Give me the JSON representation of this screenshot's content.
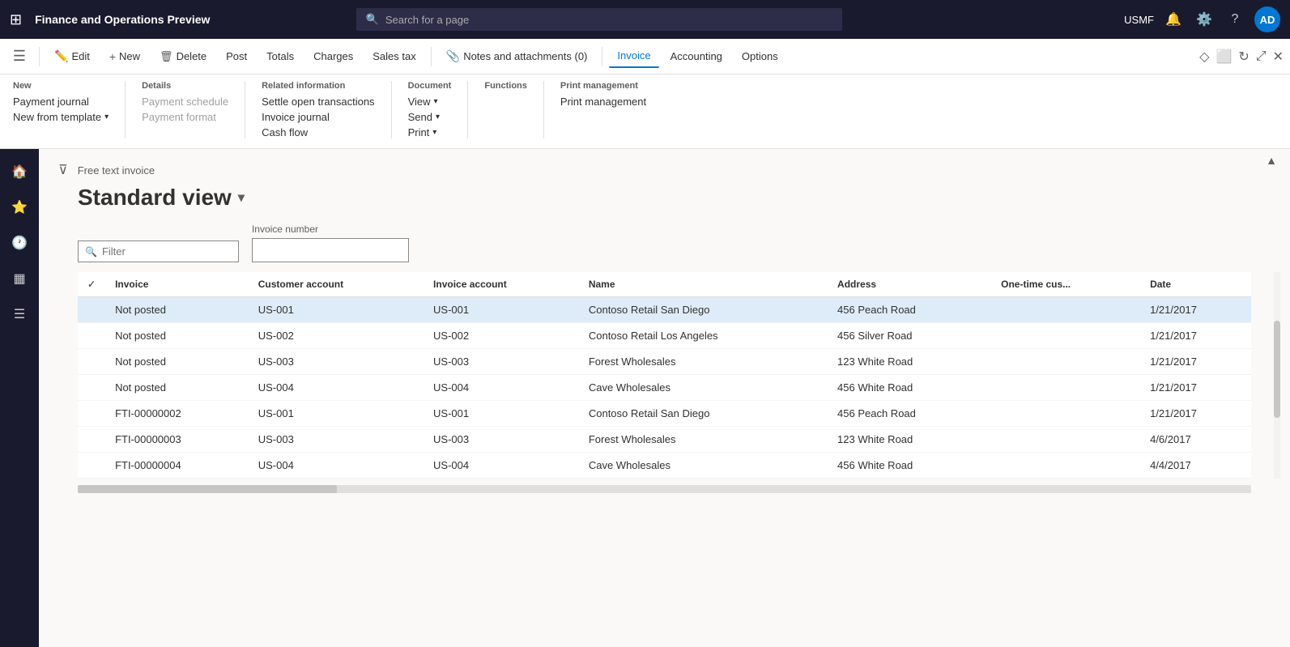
{
  "topbar": {
    "title": "Finance and Operations Preview",
    "search_placeholder": "Search for a page",
    "user": "USMF",
    "avatar": "AD"
  },
  "actionbar": {
    "buttons": [
      {
        "id": "edit",
        "label": "Edit",
        "icon": "✏️"
      },
      {
        "id": "new",
        "label": "New",
        "icon": "+"
      },
      {
        "id": "delete",
        "label": "Delete",
        "icon": "🗑"
      },
      {
        "id": "post",
        "label": "Post",
        "icon": ""
      },
      {
        "id": "totals",
        "label": "Totals",
        "icon": ""
      },
      {
        "id": "charges",
        "label": "Charges",
        "icon": ""
      },
      {
        "id": "salestax",
        "label": "Sales tax",
        "icon": ""
      },
      {
        "id": "notes",
        "label": "Notes and attachments (0)",
        "icon": "📎"
      },
      {
        "id": "invoice",
        "label": "Invoice",
        "icon": "",
        "active": true
      },
      {
        "id": "accounting",
        "label": "Accounting",
        "icon": ""
      },
      {
        "id": "options",
        "label": "Options",
        "icon": ""
      }
    ]
  },
  "ribbon": {
    "groups": [
      {
        "title": "New",
        "items": [
          {
            "id": "payment-journal",
            "label": "Payment journal",
            "disabled": false
          },
          {
            "id": "new-from-template",
            "label": "New from template",
            "hasDropdown": true,
            "disabled": false
          }
        ]
      },
      {
        "title": "Details",
        "items": [
          {
            "id": "payment-schedule",
            "label": "Payment schedule",
            "disabled": true
          },
          {
            "id": "payment-format",
            "label": "Payment format",
            "disabled": true
          }
        ]
      },
      {
        "title": "Related information",
        "items": [
          {
            "id": "settle-open",
            "label": "Settle open transactions",
            "disabled": false
          },
          {
            "id": "invoice-journal",
            "label": "Invoice journal",
            "disabled": false
          },
          {
            "id": "cash-flow",
            "label": "Cash flow",
            "disabled": false
          }
        ]
      },
      {
        "title": "Document",
        "items": [
          {
            "id": "view",
            "label": "View",
            "hasDropdown": true,
            "disabled": false
          },
          {
            "id": "send",
            "label": "Send",
            "hasDropdown": true,
            "disabled": false
          },
          {
            "id": "print",
            "label": "Print",
            "hasDropdown": true,
            "disabled": false
          }
        ]
      },
      {
        "title": "Functions",
        "items": []
      },
      {
        "title": "Print management",
        "items": [
          {
            "id": "print-management",
            "label": "Print management",
            "disabled": false
          }
        ]
      }
    ]
  },
  "sidebar": {
    "icons": [
      "☰",
      "🏠",
      "⭐",
      "🕐",
      "▦",
      "☰"
    ]
  },
  "content": {
    "breadcrumb": "Free text invoice",
    "view_title": "Standard view",
    "filter_placeholder": "Filter",
    "invoice_number_label": "Invoice number",
    "table": {
      "columns": [
        "Invoice",
        "Customer account",
        "Invoice account",
        "Name",
        "Address",
        "One-time cus...",
        "Date"
      ],
      "rows": [
        {
          "invoice": "Not posted",
          "customer": "US-001",
          "invoice_account": "US-001",
          "name": "Contoso Retail San Diego",
          "address": "456 Peach Road",
          "one_time": "",
          "date": "1/21/2017",
          "selected": true,
          "is_link": true
        },
        {
          "invoice": "Not posted",
          "customer": "US-002",
          "invoice_account": "US-002",
          "name": "Contoso Retail Los Angeles",
          "address": "456 Silver Road",
          "one_time": "",
          "date": "1/21/2017",
          "selected": false,
          "is_link": true
        },
        {
          "invoice": "Not posted",
          "customer": "US-003",
          "invoice_account": "US-003",
          "name": "Forest Wholesales",
          "address": "123 White Road",
          "one_time": "",
          "date": "1/21/2017",
          "selected": false,
          "is_link": true
        },
        {
          "invoice": "Not posted",
          "customer": "US-004",
          "invoice_account": "US-004",
          "name": "Cave Wholesales",
          "address": "456 White Road",
          "one_time": "",
          "date": "1/21/2017",
          "selected": false,
          "is_link": true
        },
        {
          "invoice": "FTI-00000002",
          "customer": "US-001",
          "invoice_account": "US-001",
          "name": "Contoso Retail San Diego",
          "address": "456 Peach Road",
          "one_time": "",
          "date": "1/21/2017",
          "selected": false,
          "is_link": true
        },
        {
          "invoice": "FTI-00000003",
          "customer": "US-003",
          "invoice_account": "US-003",
          "name": "Forest Wholesales",
          "address": "123 White Road",
          "one_time": "",
          "date": "4/6/2017",
          "selected": false,
          "is_link": true
        },
        {
          "invoice": "FTI-00000004",
          "customer": "US-004",
          "invoice_account": "US-004",
          "name": "Cave Wholesales",
          "address": "456 White Road",
          "one_time": "",
          "date": "4/4/2017",
          "selected": false,
          "is_link": true
        }
      ]
    }
  },
  "colors": {
    "accent": "#0078d4",
    "topbar_bg": "#1a1a2e",
    "selected_row": "#deecf9"
  }
}
